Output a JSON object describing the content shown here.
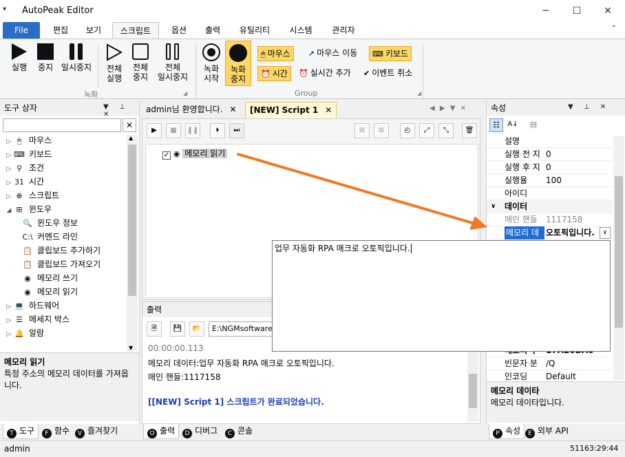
{
  "window": {
    "title": "AutoPeak Editor",
    "minimize": "─",
    "maximize": "☐",
    "close": "✕",
    "menu_glyph": "▾"
  },
  "menu": {
    "file": "File",
    "tabs": [
      "편집",
      "보기",
      "스크립트",
      "옵션",
      "출력",
      "유틸리티",
      "시스템",
      "관리자"
    ],
    "collapse": "⌃"
  },
  "ribbon": {
    "run": "실행",
    "stop": "중지",
    "pause": "일시중지",
    "run_all": [
      "전체",
      "실행"
    ],
    "stop_all": [
      "전체",
      "중지"
    ],
    "pause_all": [
      "전체",
      "일시중지"
    ],
    "rec_start": [
      "녹화",
      "시작"
    ],
    "rec_stop": [
      "녹화",
      "중지"
    ],
    "group_rec": "녹화",
    "group_group": "Group",
    "mouse": "마우스",
    "mouse_move": "마우스 이동",
    "keyboard": "키보드",
    "time": "시간",
    "realtime_add": "실시간 추가",
    "event_cancel": "이벤트 취소"
  },
  "toolbox": {
    "title": "도구 상자",
    "items": [
      {
        "label": "마우스",
        "arrow": "▷",
        "icon": "🖱"
      },
      {
        "label": "키보드",
        "arrow": "▷",
        "icon": "⌨"
      },
      {
        "label": "조건",
        "arrow": "▷",
        "icon": "⚲"
      },
      {
        "label": "시간",
        "arrow": "▷",
        "icon": "31"
      },
      {
        "label": "스크립트",
        "arrow": "▷",
        "icon": "⊕"
      },
      {
        "label": "윈도우",
        "arrow": "◢",
        "icon": "⊞"
      },
      {
        "label": "윈도우 정보",
        "arrow": "",
        "icon": "🔍",
        "indent": true
      },
      {
        "label": "커멘드 라인",
        "arrow": "",
        "icon": "C:\\",
        "indent": true
      },
      {
        "label": "클립보드 추가하기",
        "arrow": "",
        "icon": "📋",
        "indent": true
      },
      {
        "label": "클립보드 가져오기",
        "arrow": "",
        "icon": "📋",
        "indent": true
      },
      {
        "label": "메모리 쓰기",
        "arrow": "",
        "icon": "◉",
        "indent": true
      },
      {
        "label": "메모리 읽기",
        "arrow": "",
        "icon": "◉",
        "indent": true
      },
      {
        "label": "하드웨어",
        "arrow": "▷",
        "icon": "💻"
      },
      {
        "label": "메세지 박스",
        "arrow": "▷",
        "icon": "☰"
      },
      {
        "label": "알람",
        "arrow": "▷",
        "icon": "🔔"
      }
    ],
    "desc_title": "메모리 읽기",
    "desc_text": "특정 주소의 메모리 데이터를 가져옵니다.",
    "tabs": [
      {
        "key": "T",
        "label": "도구"
      },
      {
        "key": "F",
        "label": "함수"
      },
      {
        "key": "V",
        "label": "즐겨찾기"
      }
    ]
  },
  "document": {
    "tabs": [
      {
        "label": "admin님 환영합니다.",
        "close": "✕"
      },
      {
        "label": "[NEW] Script 1",
        "close": "✕"
      }
    ],
    "nav": "◀ ▶ ▼ ✕",
    "node_label": "메모리 읽기"
  },
  "output": {
    "title": "출력",
    "path": "E:\\NGMsoftware\\",
    "lines": [
      "00:00:00.113",
      "메모리 데이터:업무 자동화 RPA 매크로 오토픽입니다.",
      "매인 핸들:1117158",
      "",
      "[[NEW] Script 1] 스크립트가 완료되었습니다."
    ],
    "tabs": [
      {
        "key": "O",
        "label": "출력"
      },
      {
        "key": "D",
        "label": "디버그"
      },
      {
        "key": "C",
        "label": "콘솔"
      }
    ]
  },
  "properties": {
    "title": "속성",
    "rows": [
      {
        "k": "설명",
        "v": ""
      },
      {
        "k": "실행 전 지",
        "v": "0"
      },
      {
        "k": "실행 후 지",
        "v": "0"
      },
      {
        "k": "실행율",
        "v": "100"
      },
      {
        "k": "아이디",
        "v": ""
      }
    ],
    "category": "데이터",
    "main_handle_key": "매인 핸들",
    "main_handle_val": "1117158",
    "memory_key": "메모리 데",
    "memory_val": "오토픽입니다.",
    "hidden_rows": [
      {
        "k": "메모리 주",
        "v": "17A20BA0"
      },
      {
        "k": "빈문자 분",
        "v": "/Q"
      },
      {
        "k": "인코딩",
        "v": "Default"
      }
    ],
    "desc_title": "메모리 데이타",
    "desc_text": "메모리 데이타입니다.",
    "tabs": [
      {
        "key": "P",
        "label": "속성"
      },
      {
        "key": "E",
        "label": "외부 API"
      }
    ]
  },
  "popup": {
    "text": "업무 자동화 RPA 매크로 오토픽입니다."
  },
  "status": {
    "user": "admin",
    "time": "51163:29:44"
  }
}
